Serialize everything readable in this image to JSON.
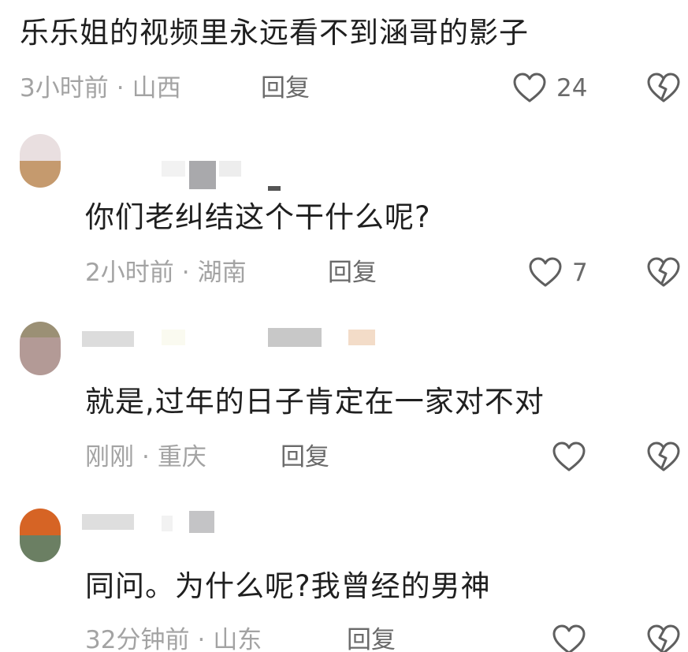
{
  "comments": [
    {
      "text": "乐乐姐的视频里永远看不到涵哥的影子",
      "time": "3小时前",
      "region": "山西",
      "reply_label": "回复",
      "like_count": "24",
      "liked_icon": "heart-outline-icon",
      "dislike_icon": "broken-heart-icon"
    },
    {
      "text": "你们老纠结这个干什么呢?",
      "time": "2小时前",
      "region": "湖南",
      "reply_label": "回复",
      "like_count": "7"
    },
    {
      "text": "就是,过年的日子肯定在一家对不对",
      "time": "刚刚",
      "region": "重庆",
      "reply_label": "回复",
      "like_count": ""
    },
    {
      "text": "同问。为什么呢?我曾经的男神",
      "time": "32分钟前",
      "region": "山东",
      "reply_label": "回复",
      "like_count": ""
    }
  ],
  "separator": "·",
  "colors": {
    "text": "#1f1f1f",
    "meta": "#a3a3a3",
    "action": "#6a6a6a"
  }
}
